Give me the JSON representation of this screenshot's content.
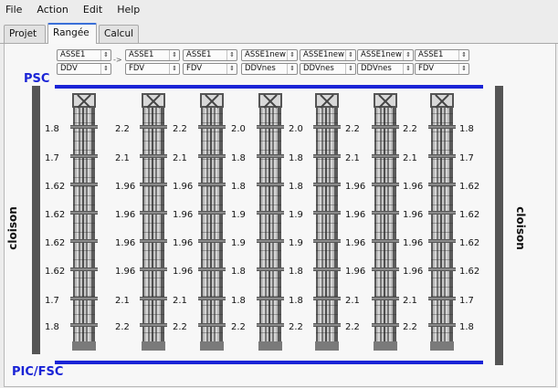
{
  "menu": [
    "File",
    "Action",
    "Edit",
    "Help"
  ],
  "tabs": [
    {
      "label": "Projet",
      "active": false
    },
    {
      "label": "Rangée",
      "active": true
    },
    {
      "label": "Calcul",
      "active": false
    }
  ],
  "selectors": {
    "top": [
      "ASSE1",
      "ASSE1",
      "ASSE1",
      "ASSE1new",
      "ASSE1new",
      "ASSE1new",
      "ASSE1"
    ],
    "bottom": [
      "DDV",
      "FDV",
      "FDV",
      "DDVnes",
      "DDVnes",
      "DDVnes",
      "FDV"
    ],
    "separator": "->"
  },
  "labels": {
    "top_line": "PSC",
    "bottom_line": "PIC/FSC",
    "left_wall": "cloison",
    "right_wall": "cloison"
  },
  "colors": {
    "line_blue": "#1a24d6",
    "wall_gray": "#555555",
    "tab_accent": "#3a6fd8"
  },
  "gap_values": [
    [
      "1.8",
      "2.2",
      "2.2",
      "2.0",
      "2.0",
      "2.2",
      "2.2",
      "1.8"
    ],
    [
      "1.7",
      "2.1",
      "2.1",
      "1.8",
      "1.8",
      "2.1",
      "2.1",
      "1.7"
    ],
    [
      "1.62",
      "1.96",
      "1.96",
      "1.8",
      "1.8",
      "1.96",
      "1.96",
      "1.62"
    ],
    [
      "1.62",
      "1.96",
      "1.96",
      "1.9",
      "1.9",
      "1.96",
      "1.96",
      "1.62"
    ],
    [
      "1.62",
      "1.96",
      "1.96",
      "1.9",
      "1.9",
      "1.96",
      "1.96",
      "1.62"
    ],
    [
      "1.62",
      "1.96",
      "1.96",
      "1.8",
      "1.8",
      "1.96",
      "1.96",
      "1.62"
    ],
    [
      "1.7",
      "2.1",
      "2.1",
      "1.8",
      "1.8",
      "2.1",
      "2.1",
      "1.7"
    ],
    [
      "1.8",
      "2.2",
      "2.2",
      "2.2",
      "2.2",
      "2.2",
      "2.2",
      "1.8"
    ]
  ]
}
